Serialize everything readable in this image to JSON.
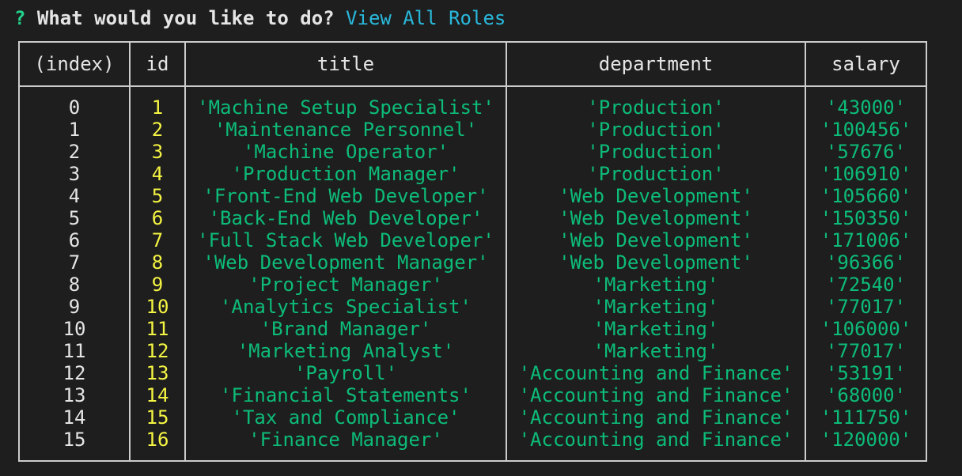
{
  "prompt": {
    "marker": "?",
    "question": "What would you like to do?",
    "answer": "View All Roles"
  },
  "table": {
    "headers": [
      "(index)",
      "id",
      "title",
      "department",
      "salary"
    ],
    "rows": [
      {
        "index": "0",
        "id": "1",
        "title": "'Machine Setup Specialist'",
        "department": "'Production'",
        "salary": "'43000'"
      },
      {
        "index": "1",
        "id": "2",
        "title": "'Maintenance Personnel'",
        "department": "'Production'",
        "salary": "'100456'"
      },
      {
        "index": "2",
        "id": "3",
        "title": "'Machine Operator'",
        "department": "'Production'",
        "salary": "'57676'"
      },
      {
        "index": "3",
        "id": "4",
        "title": "'Production Manager'",
        "department": "'Production'",
        "salary": "'106910'"
      },
      {
        "index": "4",
        "id": "5",
        "title": "'Front-End Web Developer'",
        "department": "'Web Development'",
        "salary": "'105660'"
      },
      {
        "index": "5",
        "id": "6",
        "title": "'Back-End Web Developer'",
        "department": "'Web Development'",
        "salary": "'150350'"
      },
      {
        "index": "6",
        "id": "7",
        "title": "'Full Stack Web Developer'",
        "department": "'Web Development'",
        "salary": "'171006'"
      },
      {
        "index": "7",
        "id": "8",
        "title": "'Web Development Manager'",
        "department": "'Web Development'",
        "salary": "'96366'"
      },
      {
        "index": "8",
        "id": "9",
        "title": "'Project Manager'",
        "department": "'Marketing'",
        "salary": "'72540'"
      },
      {
        "index": "9",
        "id": "10",
        "title": "'Analytics Specialist'",
        "department": "'Marketing'",
        "salary": "'77017'"
      },
      {
        "index": "10",
        "id": "11",
        "title": "'Brand Manager'",
        "department": "'Marketing'",
        "salary": "'106000'"
      },
      {
        "index": "11",
        "id": "12",
        "title": "'Marketing Analyst'",
        "department": "'Marketing'",
        "salary": "'77017'"
      },
      {
        "index": "12",
        "id": "13",
        "title": "'Payroll'",
        "department": "'Accounting and Finance'",
        "salary": "'53191'"
      },
      {
        "index": "13",
        "id": "14",
        "title": "'Financial Statements'",
        "department": "'Accounting and Finance'",
        "salary": "'68000'"
      },
      {
        "index": "14",
        "id": "15",
        "title": "'Tax and Compliance'",
        "department": "'Accounting and Finance'",
        "salary": "'111750'"
      },
      {
        "index": "15",
        "id": "16",
        "title": "'Finance Manager'",
        "department": "'Accounting and Finance'",
        "salary": "'120000'"
      }
    ]
  },
  "colors": {
    "background": "#1e1e1e",
    "prompt_marker": "#23d18b",
    "prompt_answer": "#29b8db",
    "id_values": "#f5f543",
    "string_values": "#0dbc79",
    "border": "#cccccc"
  }
}
